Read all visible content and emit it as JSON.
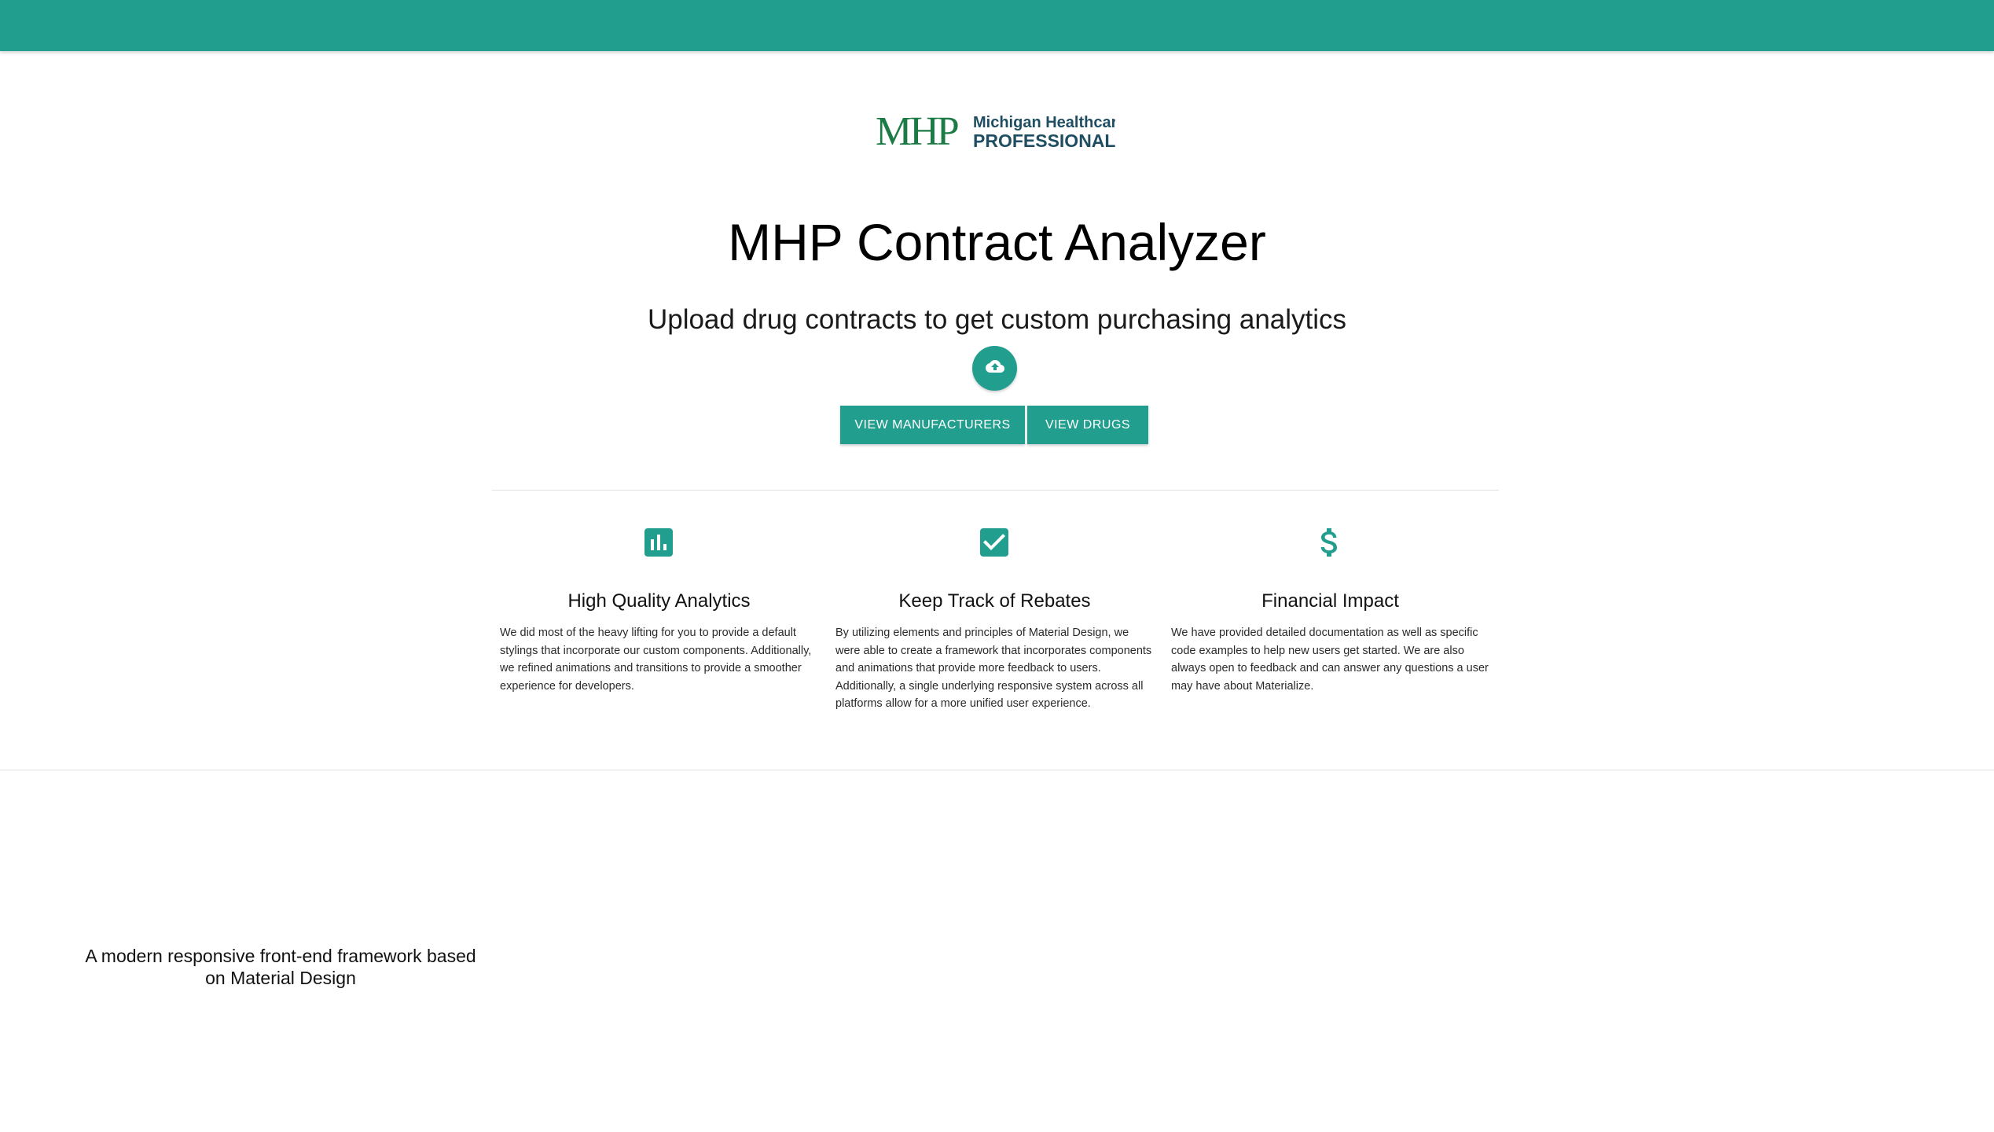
{
  "brand": {
    "logo_mark": "MHP",
    "logo_line1": "Michigan Healthcare",
    "logo_line2": "PROFESSIONALS",
    "accent_color": "#229e8f",
    "logo_color": "#1c7a45"
  },
  "header": {
    "title": "MHP Contract Analyzer",
    "subtitle": "Upload drug contracts to get custom purchasing analytics"
  },
  "actions": {
    "upload_icon": "cloud-upload-icon",
    "view_manufacturers_label": "VIEW MANUFACTURERS",
    "view_drugs_label": "VIEW DRUGS"
  },
  "features": [
    {
      "icon": "bar-chart-icon",
      "title": "High Quality Analytics",
      "text": "We did most of the heavy lifting for you to provide a default stylings that incorporate our custom components. Additionally, we refined animations and transitions to provide a smoother experience for developers."
    },
    {
      "icon": "check-box-icon",
      "title": "Keep Track of Rebates",
      "text": "By utilizing elements and principles of Material Design, we were able to create a framework that incorporates components and animations that provide more feedback to users. Additionally, a single underlying responsive system across all platforms allow for a more unified user experience."
    },
    {
      "icon": "dollar-icon",
      "title": "Financial Impact",
      "text": "We have provided detailed documentation as well as specific code examples to help new users get started. We are also always open to feedback and can answer any questions a user may have about Materialize."
    }
  ],
  "footer": {
    "tagline": "A modern responsive front-end framework based on Material Design"
  }
}
